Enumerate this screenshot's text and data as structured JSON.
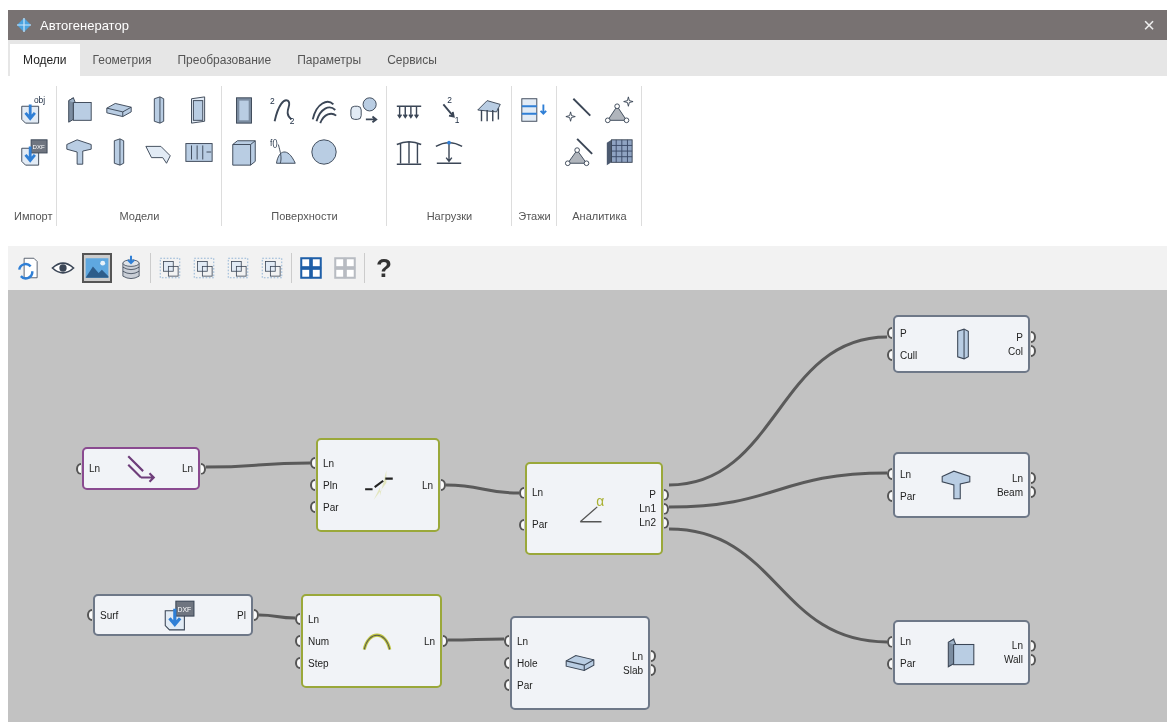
{
  "window": {
    "title": "Автогенератор",
    "close": "×"
  },
  "tabs": [
    {
      "label": "Модели",
      "selected": true
    },
    {
      "label": "Геометрия",
      "selected": false
    },
    {
      "label": "Преобразование",
      "selected": false
    },
    {
      "label": "Параметры",
      "selected": false
    },
    {
      "label": "Сервисы",
      "selected": false
    }
  ],
  "ribbon": {
    "groups": [
      {
        "label": "Импорт",
        "tools": [
          {
            "kind": "import-obj",
            "marks": [
              "obj"
            ]
          },
          {
            "kind": "import-dxf",
            "marks": [
              "DXF"
            ]
          }
        ]
      },
      {
        "label": "Модели",
        "tools": [
          {
            "kind": "wall"
          },
          {
            "kind": "slab"
          },
          {
            "kind": "column"
          },
          {
            "kind": "door"
          },
          {
            "kind": "beam"
          },
          {
            "kind": "column"
          },
          {
            "kind": "ramp"
          },
          {
            "kind": "panel"
          }
        ]
      },
      {
        "label": "Поверхности",
        "tools": [
          {
            "kind": "box-panel"
          },
          {
            "kind": "curve",
            "marks": [
              "2",
              "2"
            ]
          },
          {
            "kind": "loft"
          },
          {
            "kind": "cylinder-sphere"
          },
          {
            "kind": "cube"
          },
          {
            "kind": "dome",
            "marks": [
              "f()"
            ]
          },
          {
            "kind": "sphere"
          }
        ]
      },
      {
        "label": "Нагрузки",
        "tools": [
          {
            "kind": "distributed-load"
          },
          {
            "kind": "point-load",
            "marks": [
              "2",
              "1"
            ]
          },
          {
            "kind": "area-load"
          },
          {
            "kind": "arc-load"
          },
          {
            "kind": "point-arc-load"
          }
        ]
      },
      {
        "label": "Этажи",
        "tools": [
          {
            "kind": "floors"
          }
        ]
      },
      {
        "label": "Аналитика",
        "tools": [
          {
            "kind": "line-point"
          },
          {
            "kind": "triangle-point"
          },
          {
            "kind": "triangle-line"
          },
          {
            "kind": "grid-block"
          }
        ]
      }
    ]
  },
  "toolbar": [
    {
      "kind": "refresh",
      "selected": false
    },
    {
      "kind": "eye",
      "selected": false
    },
    {
      "kind": "image",
      "selected": true
    },
    {
      "kind": "database",
      "selected": false
    },
    {
      "kind": "select-frame",
      "selected": false
    },
    {
      "kind": "select-frame",
      "selected": false
    },
    {
      "kind": "select-frame",
      "selected": false
    },
    {
      "kind": "select-frame",
      "selected": false
    },
    {
      "kind": "grid-large",
      "selected": false
    },
    {
      "kind": "grid-small",
      "selected": false
    },
    {
      "kind": "help",
      "label": "?",
      "selected": false
    }
  ],
  "canvas": {
    "nodes": [
      {
        "color": "#8a4a90",
        "icon": {
          "kind": "offset-line"
        },
        "inputs": [
          "Ln"
        ],
        "outputs": [
          "Ln"
        ]
      },
      {
        "color": "#9aa83a",
        "icon": {
          "kind": "split-line"
        },
        "inputs": [
          "Ln",
          "Pln",
          "Par"
        ],
        "outputs": [
          "Ln"
        ]
      },
      {
        "color": "#9aa83a",
        "icon": {
          "kind": "angle",
          "marks": [
            "α"
          ]
        },
        "inputs": [
          "Ln",
          "Par"
        ],
        "outputs": [
          "P",
          "Ln1",
          "Ln2"
        ]
      },
      {
        "color": "#6e7888",
        "icon": {
          "kind": "column"
        },
        "inputs": [
          "P",
          "Cull"
        ],
        "outputs": [
          "P",
          "Col"
        ]
      },
      {
        "color": "#6e7888",
        "icon": {
          "kind": "beam"
        },
        "inputs": [
          "Ln",
          "Par"
        ],
        "outputs": [
          "Ln",
          "Beam"
        ]
      },
      {
        "color": "#6e7888",
        "icon": {
          "kind": "wall"
        },
        "inputs": [
          "Ln",
          "Par"
        ],
        "outputs": [
          "Ln",
          "Wall"
        ]
      },
      {
        "color": "#6e7888",
        "icon": {
          "kind": "import-dxf",
          "marks": [
            "DXF"
          ]
        },
        "inputs": [
          "Surf"
        ],
        "outputs": [
          "Pl"
        ]
      },
      {
        "color": "#9aa83a",
        "icon": {
          "kind": "arc"
        },
        "inputs": [
          "Ln",
          "Num",
          "Step"
        ],
        "outputs": [
          "Ln"
        ]
      },
      {
        "color": "#6e7888",
        "icon": {
          "kind": "slab"
        },
        "inputs": [
          "Ln",
          "Hole",
          "Par"
        ],
        "outputs": [
          "Ln",
          "Slab"
        ]
      }
    ]
  }
}
